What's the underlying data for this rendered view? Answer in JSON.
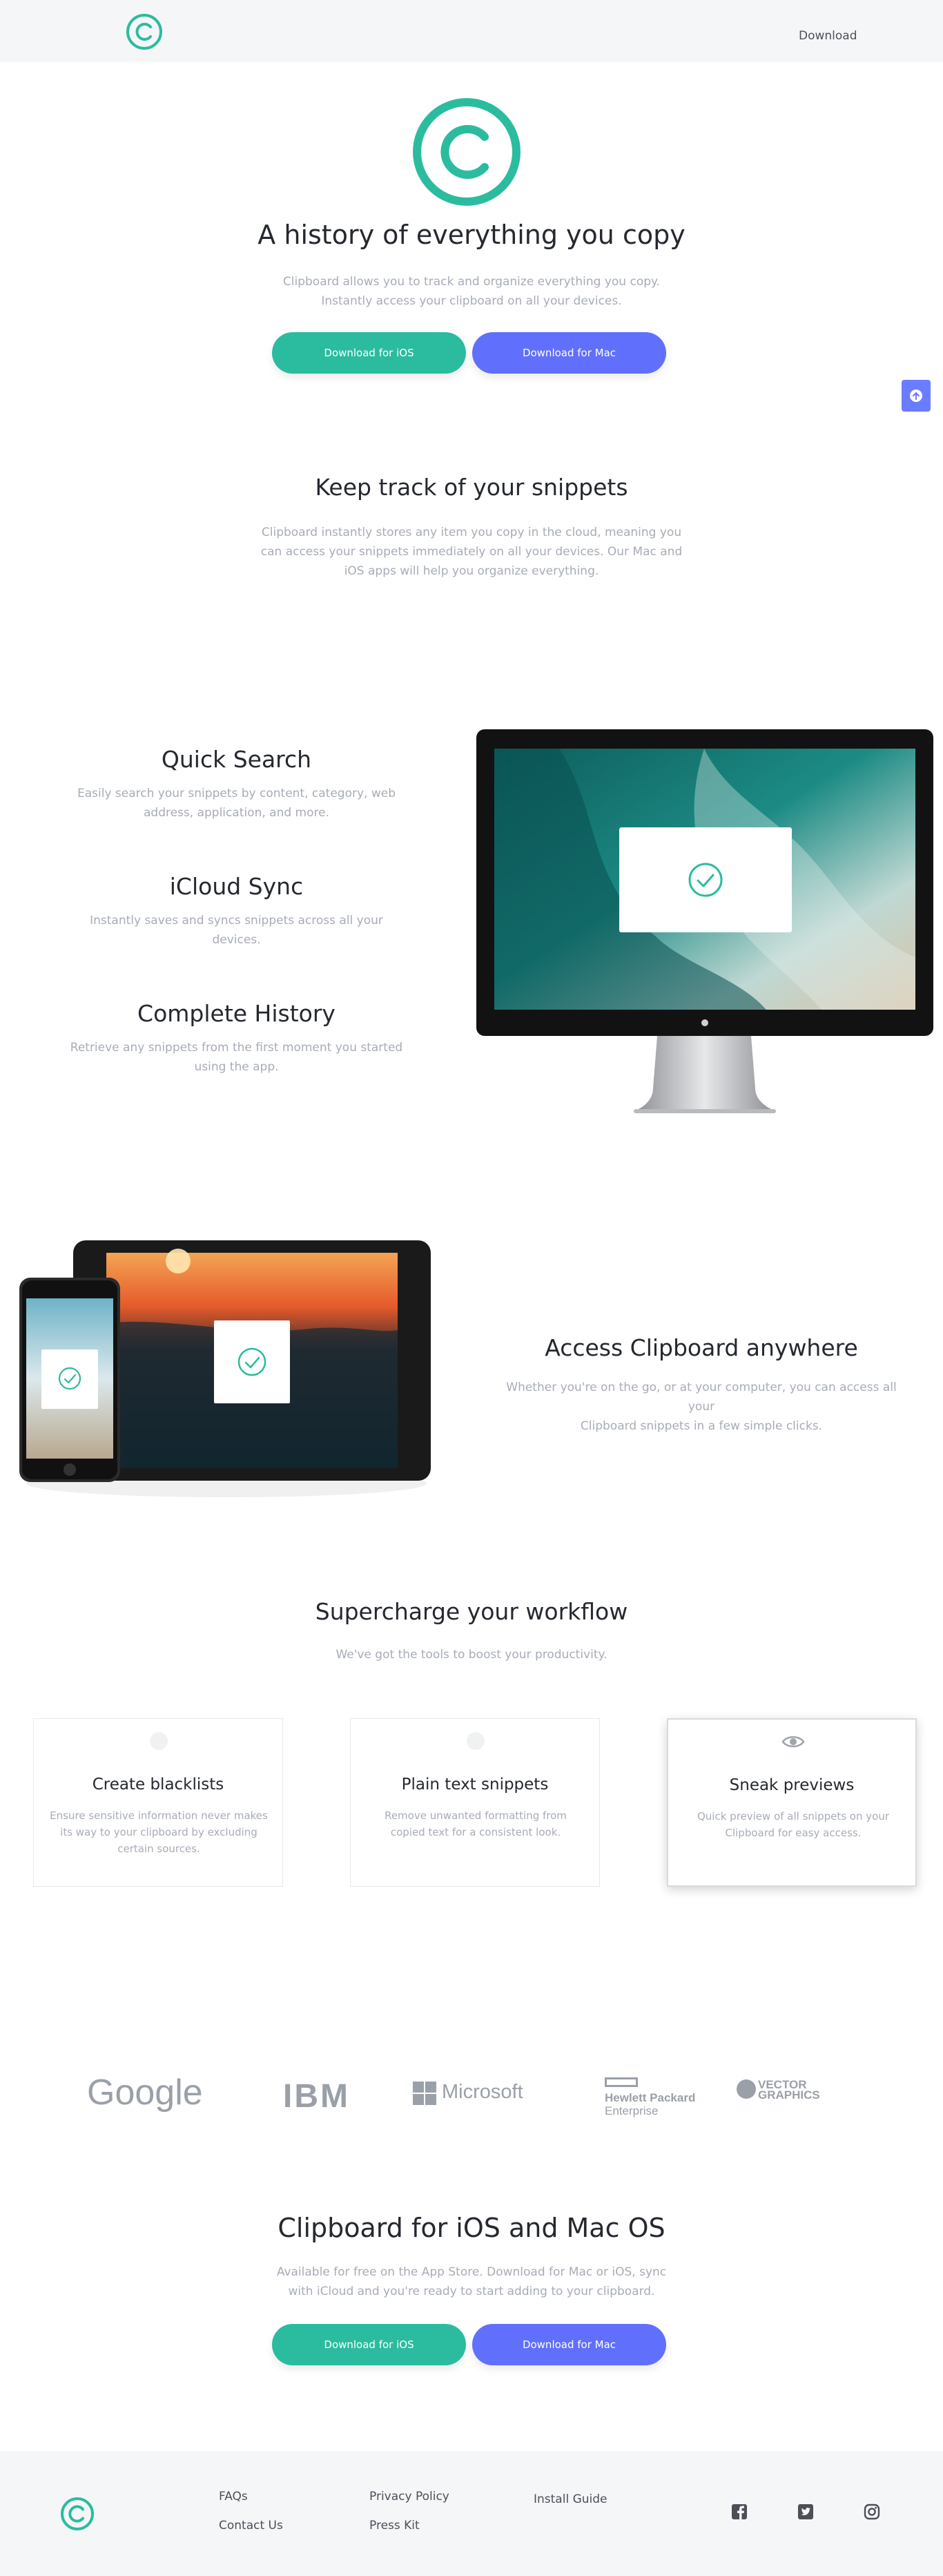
{
  "nav": {
    "download_link": "Download"
  },
  "hero": {
    "title": "A history of everything you copy",
    "description_line1": "Clipboard allows you to track and organize everything you copy.",
    "description_line2": "Instantly access your clipboard on all your devices.",
    "btn_ios": "Download for iOS",
    "btn_mac": "Download for Mac"
  },
  "snippets": {
    "title": "Keep track of your snippets",
    "line1": "Clipboard instantly stores any item you copy in the cloud, meaning you",
    "line2": "can access your snippets immediately on all your devices. Our Mac and",
    "line3": "iOS apps will help you organize everything."
  },
  "features": [
    {
      "title": "Quick Search",
      "line1": "Easily search your snippets by content, category, web",
      "line2": "address, application, and more."
    },
    {
      "title": "iCloud Sync",
      "line1": "Instantly saves and syncs snippets across all your",
      "line2": "devices."
    },
    {
      "title": "Complete History",
      "line1": "Retrieve any snippets from the first moment you started",
      "line2": "using the app."
    }
  ],
  "access": {
    "title": "Access Clipboard anywhere",
    "line1": "Whether you're on the go, or at your computer, you can access all your",
    "line2": "Clipboard snippets in a few simple clicks."
  },
  "workflow": {
    "title": "Supercharge your workflow",
    "subtitle": "We've got the tools to boost your productivity.",
    "cards": [
      {
        "title": "Create blacklists",
        "line1": "Ensure sensitive information never makes",
        "line2": "its way to your clipboard by excluding",
        "line3": "certain sources."
      },
      {
        "title": "Plain text snippets",
        "line1": "Remove unwanted formatting from",
        "line2": "copied text for a consistent look.",
        "line3": ""
      },
      {
        "title": "Sneak previews",
        "line1": "Quick preview of all snippets on your",
        "line2": "Clipboard for easy access.",
        "line3": ""
      }
    ]
  },
  "partners": {
    "google": "Google",
    "ibm": "IBM",
    "microsoft": "Microsoft",
    "hp_line1": "Hewlett Packard",
    "hp_line2": "Enterprise",
    "vector_line1": "VECTOR",
    "vector_line2": "GRAPHICS"
  },
  "cta": {
    "title": "Clipboard for iOS and Mac OS",
    "line1": "Available for free on the App Store. Download for Mac or iOS, sync",
    "line2": "with iCloud and you're ready to start adding to your clipboard.",
    "btn_ios": "Download for iOS",
    "btn_mac": "Download for Mac"
  },
  "footer": {
    "faqs": "FAQs",
    "contact": "Contact Us",
    "privacy": "Privacy Policy",
    "press": "Press Kit",
    "install": "Install Guide"
  },
  "icons": {
    "logo": "copyright-logo-icon",
    "scroll_top": "arrow-up-icon",
    "check": "check-circle-icon",
    "eye": "eye-icon",
    "facebook": "facebook-icon",
    "twitter": "twitter-icon",
    "instagram": "instagram-icon"
  },
  "colors": {
    "accent_green": "#2bbc9f",
    "accent_blue": "#6070fd",
    "heading": "#25282f",
    "muted": "#a7acb6",
    "footer_bg": "#f5f6f8"
  }
}
